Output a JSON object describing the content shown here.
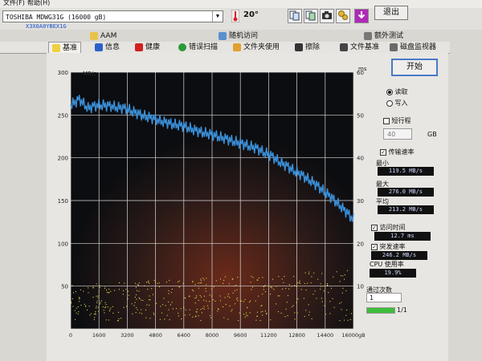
{
  "menu": {
    "items": [
      "文件(F)",
      "帮助(H)"
    ]
  },
  "toolbar": {
    "drive": "TOSHIBA MDWG31G (16000 gB)",
    "serial": "X3X0A0YBEX1G",
    "temperature": "20°",
    "exit_label": "退出"
  },
  "tabs_top": [
    {
      "label": "AAM",
      "icon": "speaker-icon"
    },
    {
      "label": "随机访问",
      "icon": "random-access-icon"
    },
    {
      "label": "额外测试",
      "icon": "extra-test-icon"
    }
  ],
  "tabs_bottom": [
    {
      "label": "基准",
      "icon": "bulb-icon"
    },
    {
      "label": "信息",
      "icon": "info-icon"
    },
    {
      "label": "健康",
      "icon": "health-icon"
    },
    {
      "label": "错误扫描",
      "icon": "search-icon"
    },
    {
      "label": "文件夹使用",
      "icon": "folder-icon"
    },
    {
      "label": "擦除",
      "icon": "erase-icon"
    },
    {
      "label": "文件基准",
      "icon": "file-bench-icon"
    },
    {
      "label": "磁盘监视器",
      "icon": "monitor-icon"
    }
  ],
  "controls": {
    "start_label": "开始",
    "read_label": "读取",
    "write_label": "写入",
    "short_label": "短行程",
    "gb_value": "40",
    "gb_unit": "GB",
    "transfer_label": "传输速率",
    "min_label": "最小",
    "min_value": "119.5 MB/s",
    "max_label": "最大",
    "max_value": "276.0 MB/s",
    "avg_label": "平均",
    "avg_value": "213.2 MB/s",
    "access_label": "访问时间",
    "access_value": "12.7 ms",
    "burst_label": "突发速率",
    "burst_value": "246.2 MB/s",
    "cpu_label": "CPU 使用率",
    "cpu_value": "19.9%",
    "passes_label": "通过次数",
    "passes_value": "1",
    "pass_counter": "1/1",
    "pass_progress": 1.0
  },
  "chart_data": {
    "type": "line",
    "left_axis_unit": "MB/s",
    "right_axis_unit": "ms",
    "x_unit": "gB",
    "xlim": [
      0,
      16000
    ],
    "ylim": [
      0,
      300
    ],
    "y2lim": [
      0,
      60
    ],
    "x_ticks": [
      0,
      1600,
      3200,
      4800,
      6400,
      8000,
      9600,
      11200,
      12800,
      14400,
      16000
    ],
    "y_ticks": [
      50,
      100,
      150,
      200,
      250,
      300
    ],
    "y2_ticks": [
      10,
      20,
      30,
      40,
      50,
      60
    ],
    "grid": true,
    "series": [
      {
        "color": "#3a8fd8",
        "x": [
          0,
          500,
          1000,
          1600,
          2400,
          3200,
          4000,
          4800,
          5600,
          6400,
          7200,
          8000,
          8800,
          9600,
          10400,
          11200,
          12000,
          12800,
          13600,
          14400,
          15200,
          16000
        ],
        "values": [
          262,
          268,
          258,
          262,
          260,
          257,
          250,
          245,
          240,
          237,
          231,
          227,
          222,
          217,
          212,
          204,
          193,
          183,
          173,
          160,
          145,
          128
        ]
      }
    ],
    "access_time_color": "#d8d84a",
    "access_time_range_ms": [
      2,
      14
    ]
  }
}
